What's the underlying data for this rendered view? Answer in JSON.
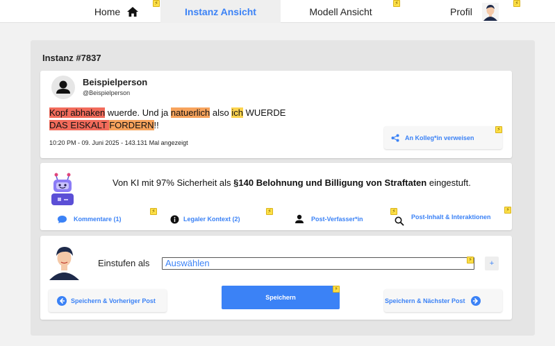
{
  "nav": {
    "home_label": "Home",
    "instanz_label": "Instanz Ansicht",
    "modell_label": "Modell Ansicht",
    "profil_label": "Profil"
  },
  "panel": {
    "title": "Instanz #7837"
  },
  "post": {
    "author_name": "Beispielperson",
    "author_handle": "@Beispielperson",
    "segments": {
      "s1": "Kopf abhaken",
      "s2": " wuerde. Und ja ",
      "s3": "natuerlich",
      "s4": " also ",
      "s5": "ich",
      "s6": " WUERDE",
      "s7": "DAS EISKALT ",
      "s8": "FORDERN",
      "s9": "!!"
    },
    "meta": "10:20 PM - 09. Juni 2025 - 143.131 Mal angezeigt",
    "share_label": "An Kolleg*in verweisen"
  },
  "ai": {
    "prefix": "Von KI mit 97% Sicherheit als ",
    "category": "§140 Belohnung und Billigung von Straftaten",
    "suffix": " eingestuft."
  },
  "info_tabs": {
    "comments": "Kommentare (1)",
    "legal": "Legaler Kontext (2)",
    "author": "Post-Verfasser*in",
    "content": "Post-Inhalt & Interaktionen"
  },
  "classify": {
    "label": "Einstufen als",
    "select_value": "Auswählen",
    "plus_label": "+"
  },
  "buttons": {
    "prev": "Speichern & Vorheriger Post",
    "save": "Speichern",
    "next": "Speichern & Nächster Post"
  },
  "colors": {
    "accent": "#3b82f6",
    "highlight_red": "#f26b5b",
    "highlight_orange": "#f7a35c",
    "highlight_yellow": "#fcd34d",
    "flash_badge": "#fde047"
  },
  "icons": {
    "home": "home-icon",
    "profile_avatar": "avatar",
    "user": "user-icon",
    "share": "share-icon",
    "robot": "robot-icon",
    "comment": "comment-icon",
    "info": "info-icon",
    "person": "person-icon",
    "search": "search-icon",
    "arrow_left": "arrow-left-icon",
    "arrow_right": "arrow-right-icon",
    "flash": "flash-icon"
  }
}
